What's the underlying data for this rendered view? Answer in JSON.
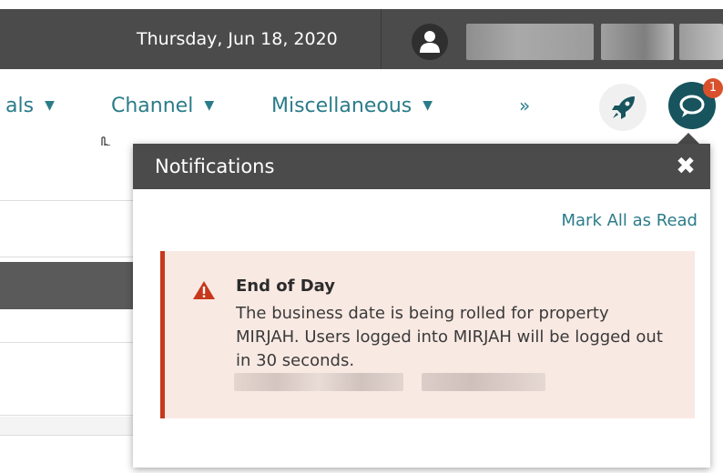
{
  "header": {
    "date": "Thursday, Jun 18, 2020",
    "user_icon": "user-icon"
  },
  "nav": {
    "items": [
      {
        "label": "als",
        "icon": "caret-down-icon"
      },
      {
        "label": "Channel",
        "icon": "caret-down-icon"
      },
      {
        "label": "Miscellaneous",
        "icon": "caret-down-icon"
      }
    ],
    "more_label": "»",
    "rocket_icon": "rocket-icon",
    "chat_icon": "chat-icon",
    "notification_count": "1"
  },
  "notifications": {
    "title": "Notifications",
    "close_label": "✖",
    "mark_all_read": "Mark All as Read",
    "items": [
      {
        "icon": "warning-icon",
        "title": "End of Day",
        "message": "The business date is being rolled for property MIRJAH. Users logged into MIRJAH will be logged out in 30 seconds."
      }
    ]
  },
  "colors": {
    "header_bg": "#4b4b4b",
    "accent": "#2b7c8a",
    "chat_bg": "#17545e",
    "badge": "#d9512c",
    "alert_border": "#c7381b",
    "alert_bg": "#f9e9e3"
  }
}
